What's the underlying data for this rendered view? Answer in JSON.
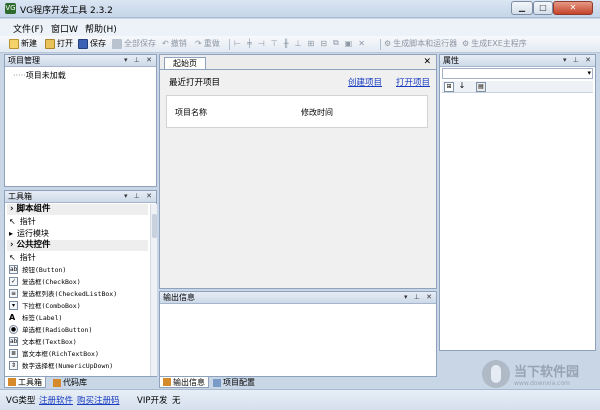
{
  "window": {
    "title": "VG程序开发工具 2.3.2",
    "icon_text": "VG"
  },
  "menu": [
    "文件(F)",
    "窗口W",
    "帮助(H)"
  ],
  "toolbar": {
    "new": "新建",
    "open": "打开",
    "save": "保存",
    "save_all": "全部保存",
    "undo": "撤销",
    "redo": "重做",
    "gen_script": "生成脚本和运行器",
    "gen_exe": "生成EXE主程序"
  },
  "project_panel": {
    "title": "项目管理",
    "tree_item": "项目未加载"
  },
  "toolbox": {
    "title": "工具箱",
    "categories": [
      {
        "name": "脚本组件",
        "items": [
          "指针",
          "运行模块"
        ]
      },
      {
        "name": "公共控件",
        "items": [
          "指针",
          "按钮(Button)",
          "复选框(CheckBox)",
          "复选框列表(CheckedListBox)",
          "下拉框(ComboBox)",
          "标签(Label)",
          "单选框(RadioButton)",
          "文本框(TextBox)",
          "富文本框(RichTextBox)",
          "数字选择框(NumericUpDown)"
        ]
      }
    ],
    "tabs": [
      "工具箱",
      "代码库"
    ]
  },
  "start_page": {
    "tab": "起始页",
    "recent_label": "最近打开项目",
    "create_link": "创建项目",
    "open_link": "打开项目",
    "columns": [
      "项目名称",
      "修改时间"
    ]
  },
  "output_panel": {
    "title": "输出信息",
    "tabs": [
      "输出信息",
      "项目配置"
    ]
  },
  "properties_panel": {
    "title": "属性"
  },
  "status": {
    "type_label": "VG类型",
    "register": "注册软件",
    "buy": "购买注册码",
    "vip_label": "VIP开发",
    "vip_value": "无"
  },
  "watermark": {
    "main": "当下软件园",
    "sub": "www.downxia.com"
  },
  "colors": {
    "accent_link": "#1a3dc1",
    "panel_border": "#8ea2bd",
    "frame": "#c9d6e6"
  }
}
